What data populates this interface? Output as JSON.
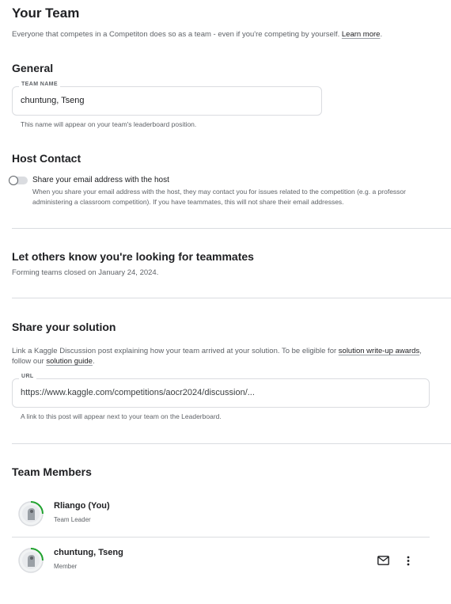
{
  "header": {
    "title": "Your Team",
    "intro_text": "Everyone that competes in a Competiton does so as a team - even if you're competing by yourself.",
    "learn_more": "Learn more",
    "intro_end": "."
  },
  "general": {
    "heading": "General",
    "team_name_label": "TEAM NAME",
    "team_name_value": "chuntung, Tseng",
    "team_name_helper": "This name will appear on your team's leaderboard position."
  },
  "host_contact": {
    "heading": "Host Contact",
    "toggle_label": "Share your email address with the host",
    "toggle_on": false,
    "toggle_desc": "When you share your email address with the host, they may contact you for issues related to the competition (e.g. a professor administering a classroom competition). If you have teammates, this will not share their email addresses."
  },
  "teammates": {
    "heading": "Let others know you're looking for teammates",
    "status": "Forming teams closed on January 24, 2024."
  },
  "solution": {
    "heading": "Share your solution",
    "desc_part1": "Link a Kaggle Discussion post explaining how your team arrived at your solution. To be eligible for ",
    "link_writeup": "solution write-up awards",
    "desc_part2": ", follow our ",
    "link_guide": "solution guide",
    "desc_part3": ".",
    "url_label": "URL",
    "url_value": "https://www.kaggle.com/competitions/aocr2024/discussion/...",
    "url_helper": "A link to this post will appear next to your team on the Leaderboard."
  },
  "members": {
    "heading": "Team Members",
    "list": [
      {
        "name": "Rliango (You)",
        "role": "Team Leader"
      },
      {
        "name": "chuntung, Tseng",
        "role": "Member"
      }
    ]
  },
  "icons": {
    "mail": "mail-icon",
    "more": "more-vertical-icon",
    "avatar_ring_color": "#20BEFF"
  },
  "colors": {
    "progress_ring": "#20a22e",
    "divider": "#dadce0",
    "text_secondary": "#5f6368"
  }
}
